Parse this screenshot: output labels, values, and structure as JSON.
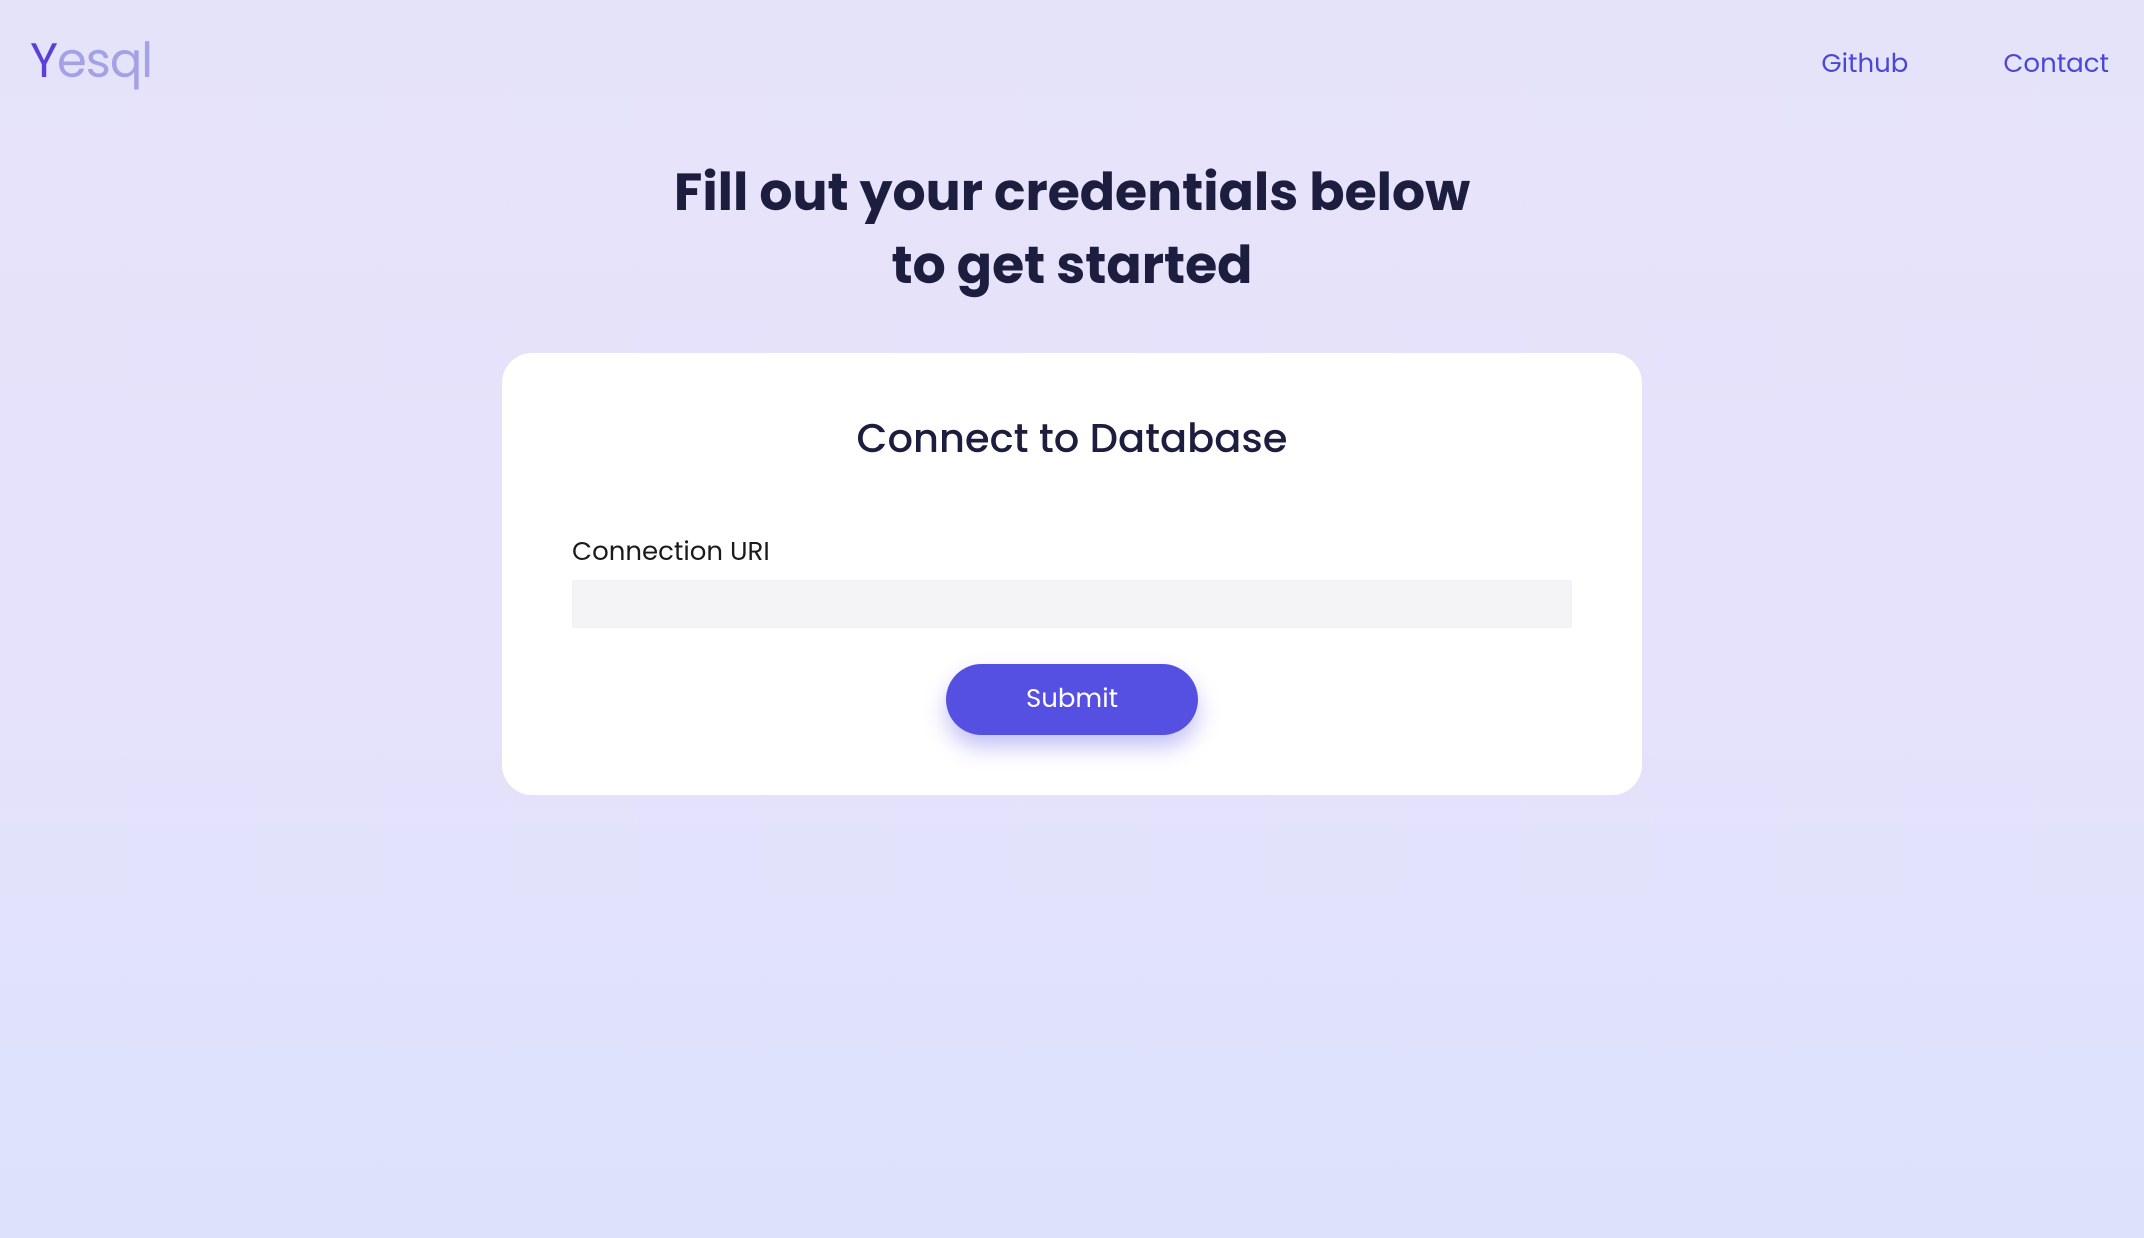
{
  "header": {
    "logo_y": "Y",
    "logo_rest": "esql",
    "nav": {
      "github": "Github",
      "contact": "Contact"
    }
  },
  "main": {
    "heading_line1": "Fill out your credentials below",
    "heading_line2": "to get started"
  },
  "card": {
    "title": "Connect to Database",
    "connection_uri_label": "Connection URI",
    "connection_uri_value": "",
    "submit_label": "Submit"
  }
}
